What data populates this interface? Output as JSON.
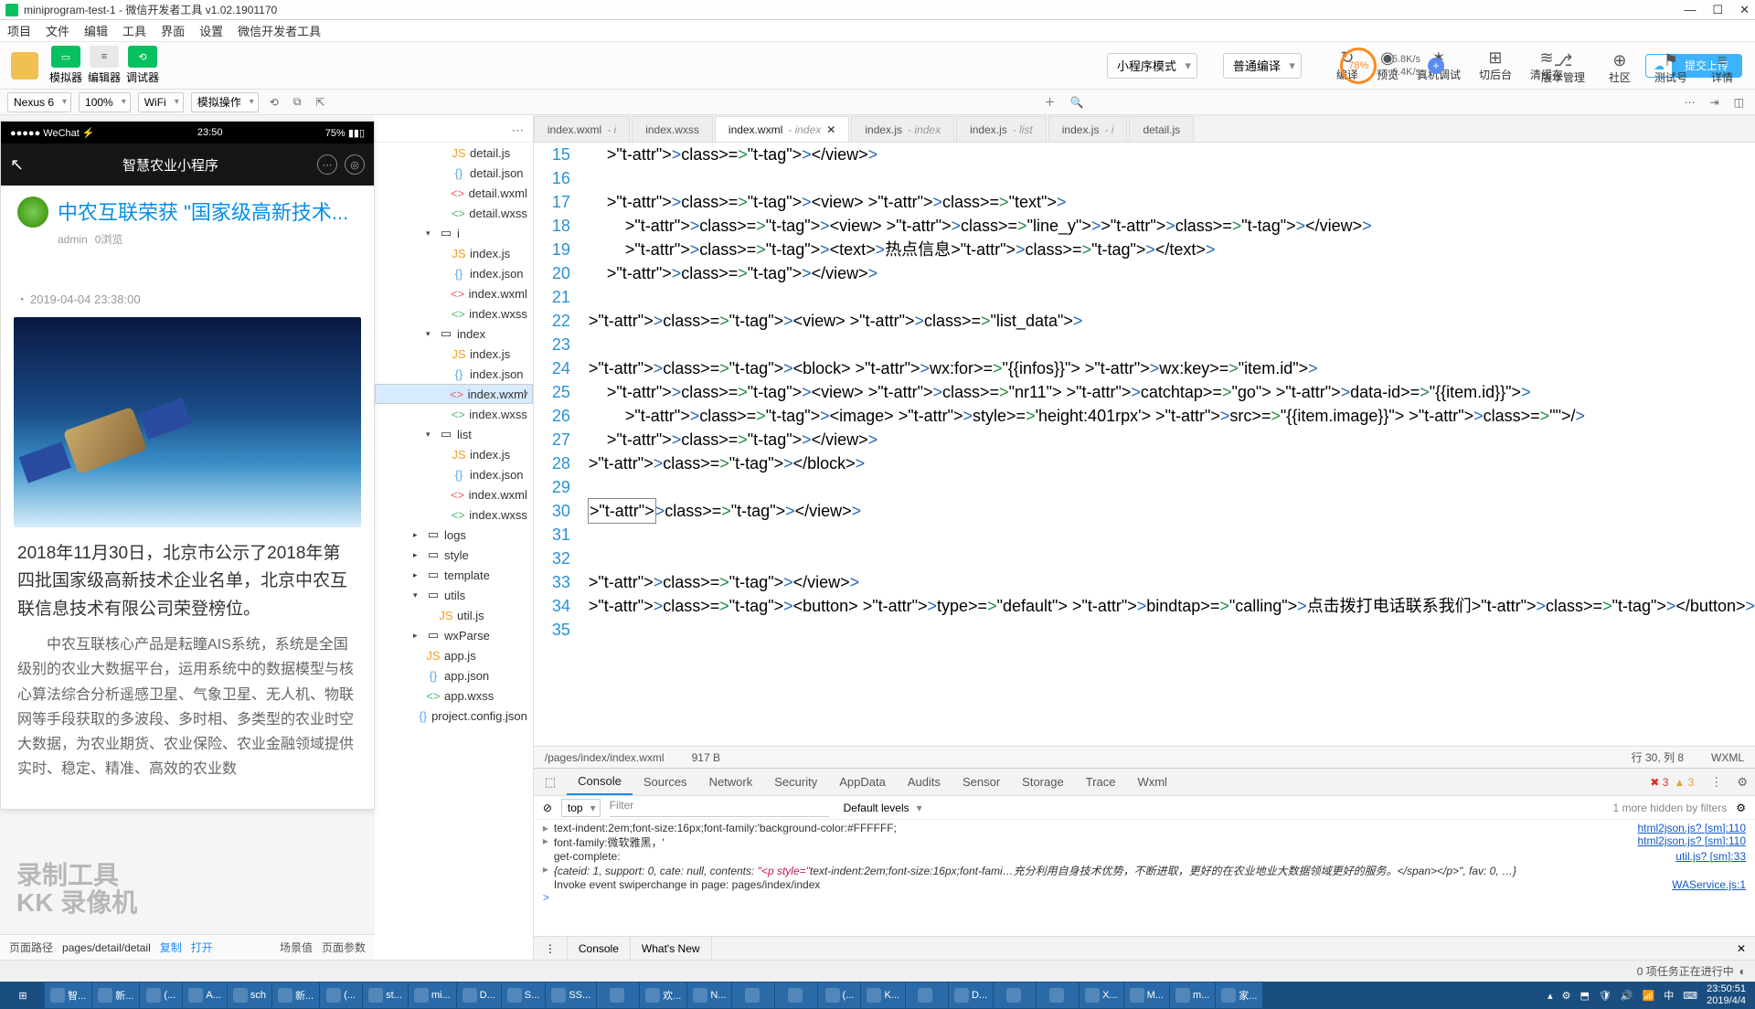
{
  "titlebar": {
    "title": "miniprogram-test-1 - 微信开发者工具 v1.02.1901170"
  },
  "menubar": [
    "项目",
    "文件",
    "编辑",
    "工具",
    "界面",
    "设置",
    "微信开发者工具"
  ],
  "toolbar": {
    "modes": {
      "sim": "模拟器",
      "editor": "编辑器",
      "debug": "调试器"
    },
    "dd1": "小程序模式",
    "dd2": "普通编译",
    "actions": {
      "compile": "编译",
      "preview": "预览",
      "realdbg": "真机调试",
      "bg": "切后台",
      "cache": "清缓存"
    },
    "right": {
      "ver": "版本管理",
      "community": "社区",
      "test": "测试号",
      "more": "详情"
    },
    "perf": {
      "pct": "78%",
      "up": "5.8K/s",
      "down": "6.4K/s"
    },
    "upload": "提交上传"
  },
  "subtoolbar": {
    "device": "Nexus 6",
    "zoom": "100%",
    "net": "WiFi",
    "mock": "模拟操作"
  },
  "phone": {
    "carrier": "●●●●● WeChat ⚡",
    "time": "23:50",
    "battery": "75% ▮▮▯",
    "title": "智慧农业小程序",
    "headline": "中农互联荣获 \"国家级高新技术...",
    "author": "admin",
    "views": "0浏览",
    "timestamp": "2019-04-04 23:38:00",
    "p1": "2018年11月30日，北京市公示了2018年第四批国家级高新技术企业名单，北京中农互联信息技术有限公司荣登榜位。",
    "p2": "中农互联核心产品是耘瞳AIS系统，系统是全国级别的农业大数据平台，运用系统中的数据模型与核心算法综合分析遥感卫星、气象卫星、无人机、物联网等手段获取的多波段、多时相、多类型的农业时空大数据，为农业期货、农业保险、农业金融领域提供实时、稳定、精准、高效的农业数"
  },
  "sim_footer": {
    "label": "页面路径",
    "path": "pages/detail/detail",
    "copy": "复制",
    "open": "打开",
    "scene": "场景值",
    "params": "页面参数"
  },
  "watermark": {
    "l1": "录制工具",
    "l2": "KK 录像机"
  },
  "filetree": [
    {
      "depth": 5,
      "type": "js",
      "name": "detail.js"
    },
    {
      "depth": 5,
      "type": "json",
      "name": "detail.json"
    },
    {
      "depth": 5,
      "type": "wxml",
      "name": "detail.wxml"
    },
    {
      "depth": 5,
      "type": "wxss",
      "name": "detail.wxss"
    },
    {
      "depth": 4,
      "type": "folder-open",
      "name": "i",
      "caret": "▾"
    },
    {
      "depth": 5,
      "type": "js",
      "name": "index.js"
    },
    {
      "depth": 5,
      "type": "json",
      "name": "index.json"
    },
    {
      "depth": 5,
      "type": "wxml",
      "name": "index.wxml"
    },
    {
      "depth": 5,
      "type": "wxss",
      "name": "index.wxss"
    },
    {
      "depth": 4,
      "type": "folder-open",
      "name": "index",
      "caret": "▾"
    },
    {
      "depth": 5,
      "type": "js",
      "name": "index.js"
    },
    {
      "depth": 5,
      "type": "json",
      "name": "index.json"
    },
    {
      "depth": 5,
      "type": "wxml",
      "name": "index.wxml",
      "sel": true
    },
    {
      "depth": 5,
      "type": "wxss",
      "name": "index.wxss"
    },
    {
      "depth": 4,
      "type": "folder-open",
      "name": "list",
      "caret": "▾"
    },
    {
      "depth": 5,
      "type": "js",
      "name": "index.js"
    },
    {
      "depth": 5,
      "type": "json",
      "name": "index.json"
    },
    {
      "depth": 5,
      "type": "wxml",
      "name": "index.wxml"
    },
    {
      "depth": 5,
      "type": "wxss",
      "name": "index.wxss"
    },
    {
      "depth": 3,
      "type": "folder",
      "name": "logs",
      "caret": "▸"
    },
    {
      "depth": 3,
      "type": "folder",
      "name": "style",
      "caret": "▸"
    },
    {
      "depth": 3,
      "type": "folder",
      "name": "template",
      "caret": "▸"
    },
    {
      "depth": 3,
      "type": "folder-open",
      "name": "utils",
      "caret": "▾"
    },
    {
      "depth": 4,
      "type": "js",
      "name": "util.js"
    },
    {
      "depth": 3,
      "type": "folder",
      "name": "wxParse",
      "caret": "▸"
    },
    {
      "depth": 3,
      "type": "js",
      "name": "app.js"
    },
    {
      "depth": 3,
      "type": "json",
      "name": "app.json"
    },
    {
      "depth": 3,
      "type": "wxss",
      "name": "app.wxss"
    },
    {
      "depth": 3,
      "type": "json",
      "name": "project.config.json"
    }
  ],
  "tabs": [
    {
      "name": "index.wxml",
      "sub": "- i"
    },
    {
      "name": "index.wxss"
    },
    {
      "name": "index.wxml",
      "sub": "- index",
      "active": true,
      "close": true
    },
    {
      "name": "index.js",
      "sub": "- index"
    },
    {
      "name": "index.js",
      "sub": "- list"
    },
    {
      "name": "index.js",
      "sub": "- i"
    },
    {
      "name": "detail.js"
    }
  ],
  "code": {
    "start": 15,
    "lines": [
      "    </view>",
      "",
      "    <view class=\"text\">",
      "        <view class=\"line_y\"></view>",
      "        <text>热点信息</text>",
      "    </view>",
      "",
      "<view class=\"list_data\">",
      "",
      "<block wx:for=\"{{infos}}\" wx:key=\"item.id\">",
      "    <view class=\"nr11\" catchtap=\"go\" data-id=\"{{item.id}}\">",
      "        <image style='height:401rpx' src=\"{{item.image}}\" class=\"\"/>",
      "    </view>",
      "</block>",
      "",
      "</view>",
      "",
      "",
      "</view>",
      "<button type=\"default\" bindtap=\"calling\">点击拨打电话联系我们</button>",
      ""
    ]
  },
  "statusline": {
    "path": "/pages/index/index.wxml",
    "size": "917 B",
    "pos": "行 30, 列 8",
    "lang": "WXML"
  },
  "devtools": {
    "tabs": [
      "Console",
      "Sources",
      "Network",
      "Security",
      "AppData",
      "Audits",
      "Sensor",
      "Storage",
      "Trace",
      "Wxml"
    ],
    "errors": "3",
    "warns": "3",
    "ctx": "top",
    "filter_placeholder": "Filter",
    "levels": "Default levels",
    "hidden": "1 more hidden by filters",
    "rows": [
      {
        "msg": "text-indent:2em;font-size:16px;font-family:'background-color:#FFFFFF;",
        "src": "html2json.js? [sm]:110",
        "tri": true
      },
      {
        "msg": "font-family:微软雅黑，'",
        "src": "html2json.js? [sm]:110",
        "tri": true
      },
      {
        "msg": "get-complete:",
        "src": "util.js? [sm]:33"
      },
      {
        "msg": "{cateid: 1, support: 0, cate: null, contents: \"<p style=\"text-indent:2em;font-size:16px;font-fami…充分利用自身技术优势，不断进取，更好的在农业地业大数据领域更好的服务。</span></p>\", fav: 0, …}",
        "src": "",
        "tri": true,
        "ital": true
      },
      {
        "msg": "Invoke event swiperchange in page: pages/index/index",
        "src": "WAService.js:1"
      }
    ],
    "prompt": ">",
    "footer": [
      "Console",
      "What's New"
    ]
  },
  "bottom_status": "0 项任务正在进行中",
  "taskbar": {
    "items": [
      "智...",
      "新...",
      "(...",
      "A...",
      "sch",
      "新...",
      "(...",
      "st...",
      "mi...",
      "D...",
      "S...",
      "SS...",
      "",
      "欢...",
      "N...",
      "",
      "",
      "(...",
      "K...",
      "",
      "D...",
      "",
      "",
      "X...",
      "M...",
      "m...",
      "家..."
    ],
    "clock": {
      "time": "23:50:51",
      "date": "2019/4/4"
    }
  }
}
